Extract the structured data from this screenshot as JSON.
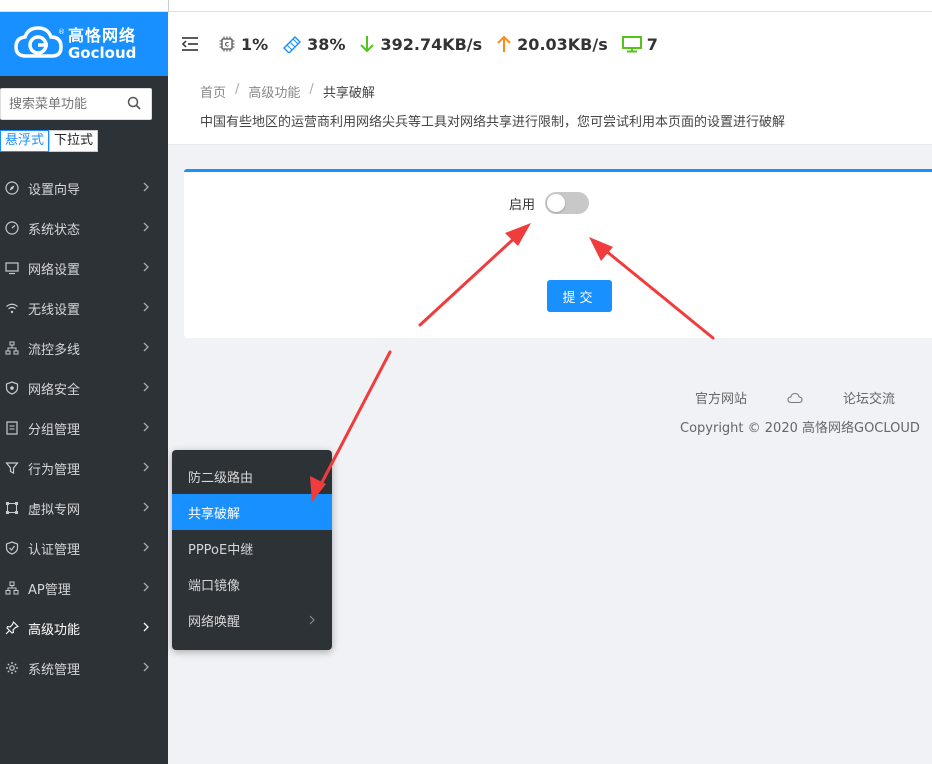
{
  "brand": {
    "name_cn": "高恪网络",
    "name_en": "Gocloud"
  },
  "sidebar": {
    "search_placeholder": "搜索菜单功能",
    "mode_float": "悬浮式",
    "mode_dropdown": "下拉式",
    "items": [
      {
        "label": "设置向导",
        "icon": "compass-icon"
      },
      {
        "label": "系统状态",
        "icon": "gauge-icon"
      },
      {
        "label": "网络设置",
        "icon": "monitor-icon"
      },
      {
        "label": "无线设置",
        "icon": "wifi-icon"
      },
      {
        "label": "流控多线",
        "icon": "network-tree-icon"
      },
      {
        "label": "网络安全",
        "icon": "shield-icon"
      },
      {
        "label": "分组管理",
        "icon": "group-icon"
      },
      {
        "label": "行为管理",
        "icon": "filter-icon"
      },
      {
        "label": "虚拟专网",
        "icon": "vpn-icon"
      },
      {
        "label": "认证管理",
        "icon": "shield-check-icon"
      },
      {
        "label": "AP管理",
        "icon": "ap-icon"
      },
      {
        "label": "高级功能",
        "icon": "pin-icon"
      },
      {
        "label": "系统管理",
        "icon": "gear-icon"
      }
    ]
  },
  "header": {
    "cpu": "1%",
    "memory": "38%",
    "download": "392.74KB/s",
    "upload": "20.03KB/s",
    "clients": "7"
  },
  "breadcrumb": {
    "home": "首页",
    "section": "高级功能",
    "current": "共享破解",
    "description": "中国有些地区的运营商利用网络尖兵等工具对网络共享进行限制，您可尝试利用本页面的设置进行破解"
  },
  "form": {
    "enable_label": "启用",
    "enabled": false,
    "submit_label": "提交"
  },
  "footer": {
    "official_site": "官方网站",
    "forum": "论坛交流",
    "copyright": "Copyright © 2020 高恪网络GOCLOUD"
  },
  "submenu": {
    "items": [
      {
        "label": "防二级路由"
      },
      {
        "label": "共享破解"
      },
      {
        "label": "PPPoE中继"
      },
      {
        "label": "端口镜像"
      },
      {
        "label": "网络唤醒"
      }
    ]
  },
  "colors": {
    "accent": "#1890ff",
    "sidebar_bg": "#2d3236",
    "download_arrow": "#52c41a",
    "upload_arrow": "#fa8c16",
    "monitor": "#52c41a",
    "annotation": "#f03c3c"
  }
}
